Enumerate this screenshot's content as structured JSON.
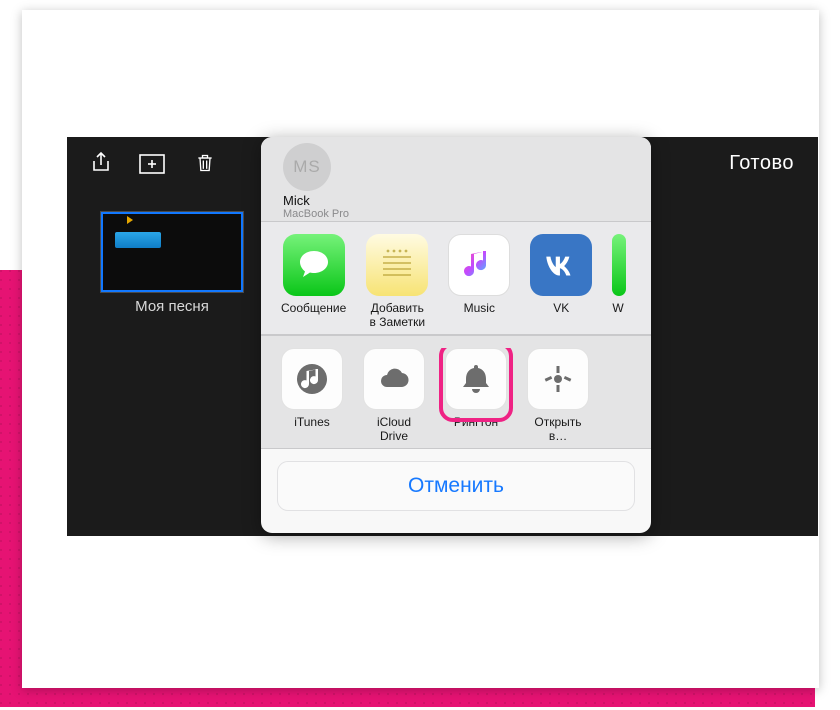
{
  "toolbar": {
    "done_label": "Готово"
  },
  "song": {
    "label": "Моя песня"
  },
  "airdrop": {
    "initials": "MS",
    "name": "Mick",
    "device": "MacBook Pro"
  },
  "share_apps": [
    {
      "id": "messages",
      "label": "Сообщение"
    },
    {
      "id": "notes",
      "label": "Добавить в Заметки"
    },
    {
      "id": "music",
      "label": "Music"
    },
    {
      "id": "vk",
      "label": "VK"
    },
    {
      "id": "more",
      "label": "W"
    }
  ],
  "share_actions": [
    {
      "id": "itunes",
      "label": "iTunes"
    },
    {
      "id": "icloud",
      "label": "iCloud Drive"
    },
    {
      "id": "ringtone",
      "label": "Рингтон",
      "highlighted": true
    },
    {
      "id": "openin",
      "label": "Открыть в…"
    }
  ],
  "cancel_label": "Отменить"
}
